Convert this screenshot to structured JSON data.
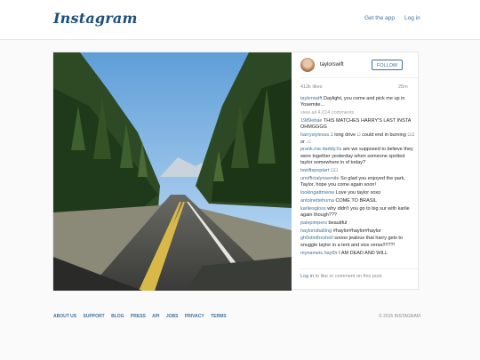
{
  "header": {
    "logo": "Instagram",
    "get_app": "Get the app",
    "login": "Log in"
  },
  "post": {
    "username": "taylorswift",
    "follow_label": "FOLLOW",
    "likes": "412k likes",
    "age": "25m",
    "caption": {
      "user": "taylorswift",
      "text": "Daylight, you come and pick me up in Yosemite..."
    },
    "view_all": "view all 4,014 comments",
    "comments": [
      {
        "user": "1989ebae",
        "text": "THIS MATCHES HARRY'S LAST INSTA OHMGGGG"
      },
      {
        "user": "harrystylesss.1",
        "text": "long drive ⃞ could end in burning ⃞⃞ or ☁️"
      },
      {
        "user": "prank.me.daddy.hs",
        "text": "are we supposed to believe they were together yesterday when someone spotted taylor somewhere in sf today?"
      },
      {
        "user": "tswiftspoptart",
        "text": "⃞⃞"
      },
      {
        "user": "unofficialyosemite",
        "text": "So glad you enjoyed the park, Taylor, hope you come again soon!"
      },
      {
        "user": "lookingattmeow",
        "text": "Love you taylor xoxo"
      },
      {
        "user": "antoinettehuma",
        "text": "COME TO BRASIL"
      },
      {
        "user": "karliesgloss",
        "text": "why didn't you go to big sur with karlie again though???"
      },
      {
        "user": "palepimpers",
        "text": "beautiful"
      },
      {
        "user": "haylorisbalIing",
        "text": "#haylor#haylor#haylor"
      },
      {
        "user": "gh0stintheshell",
        "text": "soooo jealous that harry gets to snuggle taylor in a tent and vice versa!!!!??!"
      },
      {
        "user": "mynameis.hayl0r",
        "text": "I AM DEAD AND WILL"
      }
    ],
    "login_prompt": {
      "link": "Log in",
      "text": "to like or comment on this post."
    }
  },
  "footer": {
    "links": [
      "ABOUT US",
      "SUPPORT",
      "BLOG",
      "PRESS",
      "API",
      "JOBS",
      "PRIVACY",
      "TERMS"
    ],
    "copyright": "© 2015 INSTAGRAM"
  }
}
